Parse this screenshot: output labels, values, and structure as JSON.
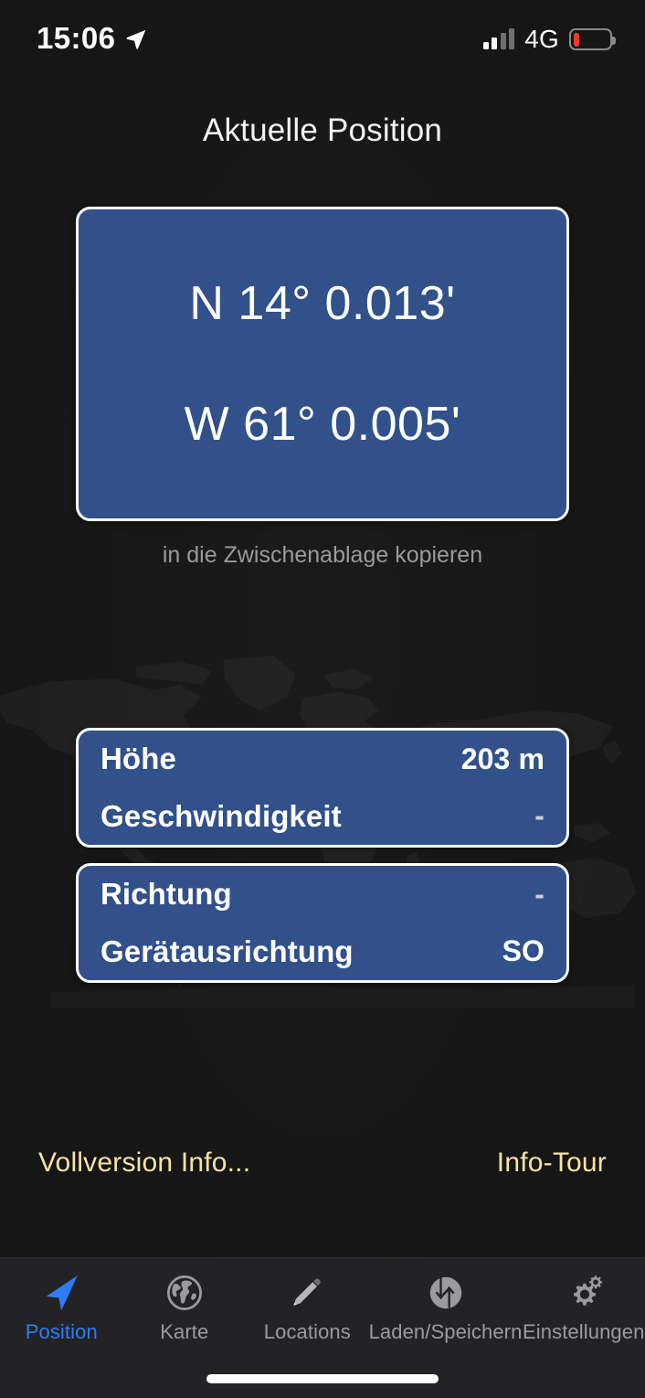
{
  "status_bar": {
    "time": "15:06",
    "location_icon": "location-arrow-icon",
    "signal_icon": "cellular-signal-icon",
    "signal_bars_active": 2,
    "signal_bars_total": 4,
    "network": "4G",
    "battery_icon": "battery-low-icon",
    "battery_percent": 18,
    "battery_color": "#f03b2c"
  },
  "header": {
    "title": "Aktuelle Position"
  },
  "coordinates": {
    "latitude": "N 14° 0.013'",
    "longitude": "W 61° 0.005'",
    "copy_hint": "in die Zwischenablage kopieren",
    "card_color": "#32518a"
  },
  "info_cards": [
    {
      "rows": [
        {
          "label": "Höhe",
          "value": "203 m"
        },
        {
          "label": "Geschwindigkeit",
          "value": "-"
        }
      ]
    },
    {
      "rows": [
        {
          "label": "Richtung",
          "value": "-"
        },
        {
          "label": "Gerätausrichtung",
          "value": "SO"
        }
      ]
    }
  ],
  "links": {
    "left": "Vollversion Info...",
    "right": "Info-Tour",
    "color": "#f7e4a4"
  },
  "tabbar": {
    "active_color": "#2f7cf6",
    "inactive_color": "#9b9b9f",
    "items": [
      {
        "label": "Position",
        "icon": "navigation-arrow-icon",
        "active": true
      },
      {
        "label": "Karte",
        "icon": "globe-icon",
        "active": false
      },
      {
        "label": "Locations",
        "icon": "pencil-icon",
        "active": false
      },
      {
        "label": "Laden/Speichern",
        "icon": "load-save-arrows-icon",
        "active": false
      },
      {
        "label": "Einstellungen",
        "icon": "gears-icon",
        "active": false
      }
    ]
  }
}
